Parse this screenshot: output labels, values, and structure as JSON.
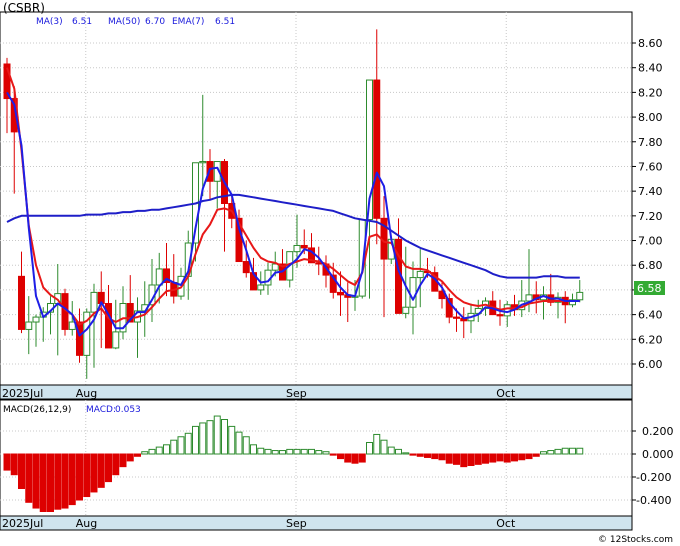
{
  "symbol": "(CSBR)",
  "legend": {
    "ma3": {
      "label": "MA(3)",
      "value": "6.51",
      "color": "#1a1adc"
    },
    "ma50": {
      "label": "MA(50)",
      "value": "6.70",
      "color": "#1a1adc"
    },
    "ema7": {
      "label": "EMA(7)",
      "value": "6.51",
      "color": "#1a1adc"
    }
  },
  "last_price": "6.58",
  "macd_legend": {
    "params": "MACD(26,12,9)",
    "label": "MACD:",
    "value": "0.053"
  },
  "watermark": "© 12Stocks.com",
  "colors": {
    "up_candle": "#2e8b2e",
    "down_candle": "#dd0000",
    "ma3": "#1e1ee6",
    "ma50": "#1e1ec8",
    "ema7": "#e81818",
    "axis_band": "#cfe4ee",
    "grid": "#c8c8c8",
    "price_tag": "#33aa33"
  },
  "chart_data": [
    {
      "type": "candlestick",
      "title": "(CSBR)",
      "ylim": [
        5.85,
        8.78
      ],
      "yticks": [
        6.0,
        6.2,
        6.4,
        6.6,
        6.8,
        7.0,
        7.2,
        7.4,
        7.6,
        7.8,
        8.0,
        8.2,
        8.4,
        8.6
      ],
      "x_labels": [
        {
          "label": "2025Jul",
          "index": 0
        },
        {
          "label": "Aug",
          "index": 11
        },
        {
          "label": "Sep",
          "index": 40
        },
        {
          "label": "Oct",
          "index": 69
        }
      ],
      "grid": true,
      "open": [
        8.43,
        8.15,
        6.71,
        6.28,
        6.34,
        6.38,
        6.42,
        6.49,
        6.57,
        6.28,
        6.34,
        6.07,
        6.42,
        6.58,
        6.49,
        6.13,
        6.26,
        6.49,
        6.34,
        6.43,
        6.48,
        6.64,
        6.77,
        6.66,
        6.55,
        6.71,
        6.98,
        7.63,
        7.64,
        7.48,
        7.64,
        7.3,
        7.18,
        6.83,
        6.74,
        6.6,
        6.64,
        6.76,
        6.81,
        6.68,
        6.91,
        6.96,
        6.94,
        6.82,
        6.81,
        6.72,
        6.58,
        6.56,
        6.54,
        6.55,
        7.17,
        8.3,
        7.18,
        6.85,
        7.01,
        6.41,
        6.46,
        6.7,
        6.75,
        6.74,
        6.59,
        6.53,
        6.38,
        6.37,
        6.35,
        6.41,
        6.45,
        6.51,
        6.4,
        6.39,
        6.48,
        6.44,
        6.51,
        6.56,
        6.52,
        6.56,
        6.5,
        6.54,
        6.48,
        6.52
      ],
      "high": [
        8.48,
        8.25,
        6.91,
        6.55,
        6.4,
        6.46,
        6.55,
        6.81,
        6.61,
        6.51,
        6.45,
        6.45,
        6.65,
        6.75,
        6.64,
        6.52,
        6.63,
        6.72,
        6.54,
        6.67,
        6.85,
        6.9,
        6.98,
        6.89,
        6.78,
        7.08,
        7.22,
        8.18,
        7.74,
        7.63,
        7.66,
        7.37,
        7.25,
        7.0,
        6.86,
        6.75,
        6.82,
        6.91,
        6.93,
        6.85,
        7.21,
        7.09,
        7.06,
        6.95,
        6.88,
        6.82,
        6.75,
        6.66,
        6.68,
        6.76,
        8.16,
        8.71,
        7.36,
        7.0,
        7.18,
        6.95,
        6.83,
        6.93,
        6.86,
        6.79,
        6.66,
        6.57,
        6.45,
        6.46,
        6.49,
        6.52,
        6.54,
        6.59,
        6.52,
        6.51,
        6.56,
        6.68,
        6.93,
        6.67,
        6.63,
        6.73,
        6.58,
        6.59,
        6.57,
        6.68
      ],
      "low": [
        7.87,
        7.38,
        6.25,
        6.08,
        6.14,
        6.18,
        6.24,
        6.07,
        6.23,
        6.23,
        6.01,
        5.88,
        5.97,
        6.13,
        6.4,
        6.12,
        6.2,
        6.4,
        6.05,
        6.22,
        6.34,
        6.49,
        6.55,
        6.49,
        6.52,
        6.52,
        6.83,
        7.36,
        7.33,
        7.26,
        6.91,
        7.1,
        6.85,
        6.7,
        6.66,
        6.56,
        6.56,
        6.71,
        6.71,
        6.62,
        6.78,
        6.89,
        6.83,
        6.72,
        6.62,
        6.53,
        6.39,
        6.34,
        6.43,
        6.53,
        6.53,
        6.97,
        6.38,
        6.81,
        6.8,
        6.37,
        6.24,
        6.46,
        6.7,
        6.65,
        6.45,
        6.33,
        6.26,
        6.21,
        6.25,
        6.34,
        6.39,
        6.42,
        6.31,
        6.3,
        6.39,
        6.38,
        6.42,
        6.41,
        6.36,
        6.47,
        6.37,
        6.33,
        6.46,
        6.5
      ],
      "close": [
        8.15,
        7.88,
        6.28,
        6.34,
        6.38,
        6.42,
        6.49,
        6.57,
        6.28,
        6.34,
        6.07,
        6.42,
        6.58,
        6.49,
        6.13,
        6.26,
        6.49,
        6.34,
        6.43,
        6.48,
        6.64,
        6.77,
        6.66,
        6.55,
        6.71,
        6.98,
        7.63,
        7.64,
        7.48,
        7.64,
        7.3,
        7.18,
        6.83,
        6.74,
        6.6,
        6.64,
        6.76,
        6.81,
        6.68,
        6.91,
        6.96,
        6.94,
        6.82,
        6.81,
        6.72,
        6.58,
        6.56,
        6.54,
        6.55,
        7.17,
        8.3,
        7.18,
        6.85,
        7.01,
        6.41,
        6.46,
        6.7,
        6.75,
        6.74,
        6.59,
        6.53,
        6.38,
        6.37,
        6.35,
        6.41,
        6.45,
        6.51,
        6.4,
        6.39,
        6.48,
        6.44,
        6.51,
        6.56,
        6.52,
        6.56,
        6.5,
        6.54,
        6.48,
        6.52,
        6.58
      ],
      "ma3": [
        8.2,
        8.1,
        7.77,
        7.1,
        6.55,
        6.38,
        6.43,
        6.49,
        6.45,
        6.4,
        6.23,
        6.28,
        6.36,
        6.5,
        6.4,
        6.29,
        6.29,
        6.36,
        6.42,
        6.42,
        6.52,
        6.63,
        6.69,
        6.66,
        6.64,
        6.75,
        7.1,
        7.42,
        7.58,
        7.59,
        7.47,
        7.37,
        7.1,
        6.92,
        6.73,
        6.66,
        6.67,
        6.74,
        6.75,
        6.8,
        6.85,
        6.93,
        6.91,
        6.86,
        6.78,
        6.7,
        6.62,
        6.56,
        6.55,
        6.75,
        7.34,
        7.55,
        7.44,
        7.01,
        6.76,
        6.63,
        6.52,
        6.64,
        6.73,
        6.69,
        6.62,
        6.5,
        6.43,
        6.37,
        6.38,
        6.4,
        6.46,
        6.45,
        6.43,
        6.42,
        6.44,
        6.48,
        6.5,
        6.53,
        6.55,
        6.53,
        6.53,
        6.51,
        6.51,
        6.51
      ],
      "ma50": [
        7.15,
        7.18,
        7.2,
        7.2,
        7.2,
        7.2,
        7.2,
        7.2,
        7.2,
        7.2,
        7.2,
        7.21,
        7.21,
        7.21,
        7.22,
        7.22,
        7.23,
        7.23,
        7.24,
        7.24,
        7.25,
        7.25,
        7.26,
        7.27,
        7.28,
        7.29,
        7.3,
        7.32,
        7.33,
        7.35,
        7.36,
        7.37,
        7.37,
        7.36,
        7.35,
        7.34,
        7.33,
        7.32,
        7.31,
        7.3,
        7.29,
        7.28,
        7.27,
        7.26,
        7.25,
        7.24,
        7.22,
        7.2,
        7.18,
        7.17,
        7.16,
        7.15,
        7.12,
        7.08,
        7.04,
        7.0,
        6.97,
        6.94,
        6.92,
        6.9,
        6.88,
        6.86,
        6.84,
        6.82,
        6.8,
        6.78,
        6.76,
        6.73,
        6.71,
        6.7,
        6.7,
        6.7,
        6.7,
        6.7,
        6.71,
        6.71,
        6.71,
        6.7,
        6.7,
        6.7
      ],
      "ema7": [
        8.4,
        8.23,
        7.73,
        7.12,
        6.8,
        6.62,
        6.56,
        6.52,
        6.44,
        6.4,
        6.32,
        6.35,
        6.41,
        6.45,
        6.37,
        6.34,
        6.37,
        6.37,
        6.38,
        6.4,
        6.46,
        6.53,
        6.59,
        6.6,
        6.62,
        6.71,
        6.89,
        7.05,
        7.13,
        7.25,
        7.26,
        7.24,
        7.14,
        7.04,
        6.94,
        6.86,
        6.83,
        6.82,
        6.79,
        6.81,
        6.83,
        6.85,
        6.84,
        6.83,
        6.81,
        6.77,
        6.72,
        6.67,
        6.64,
        6.74,
        7.03,
        7.05,
        6.99,
        6.98,
        6.88,
        6.79,
        6.77,
        6.77,
        6.76,
        6.71,
        6.67,
        6.6,
        6.54,
        6.5,
        6.48,
        6.47,
        6.48,
        6.46,
        6.44,
        6.45,
        6.45,
        6.46,
        6.49,
        6.5,
        6.51,
        6.51,
        6.51,
        6.51,
        6.51,
        6.51
      ]
    },
    {
      "type": "bar",
      "title": "MACD(26,12,9)",
      "ylim": [
        -0.53,
        0.39
      ],
      "yticks": [
        -0.4,
        -0.2,
        0.0,
        0.2
      ],
      "ytick_labels": [
        "-0.400",
        "-0.200",
        "0.000",
        "0.200"
      ],
      "x_labels": [
        {
          "label": "2025Jul",
          "index": 0
        },
        {
          "label": "Aug",
          "index": 11
        },
        {
          "label": "Sep",
          "index": 40
        },
        {
          "label": "Oct",
          "index": 69
        }
      ],
      "values": [
        -0.14,
        -0.18,
        -0.3,
        -0.42,
        -0.47,
        -0.5,
        -0.5,
        -0.48,
        -0.47,
        -0.44,
        -0.4,
        -0.37,
        -0.33,
        -0.29,
        -0.24,
        -0.18,
        -0.11,
        -0.06,
        -0.02,
        0.02,
        0.04,
        0.06,
        0.08,
        0.12,
        0.15,
        0.18,
        0.24,
        0.27,
        0.29,
        0.33,
        0.3,
        0.24,
        0.19,
        0.15,
        0.08,
        0.05,
        0.04,
        0.03,
        0.03,
        0.04,
        0.04,
        0.04,
        0.04,
        0.03,
        0.02,
        -0.01,
        -0.04,
        -0.07,
        -0.08,
        -0.07,
        0.1,
        0.17,
        0.12,
        0.06,
        0.04,
        0.01,
        -0.01,
        -0.02,
        -0.03,
        -0.04,
        -0.05,
        -0.08,
        -0.09,
        -0.11,
        -0.1,
        -0.09,
        -0.08,
        -0.07,
        -0.06,
        -0.07,
        -0.06,
        -0.05,
        -0.04,
        -0.02,
        0.02,
        0.03,
        0.04,
        0.05,
        0.05,
        0.05
      ]
    }
  ]
}
